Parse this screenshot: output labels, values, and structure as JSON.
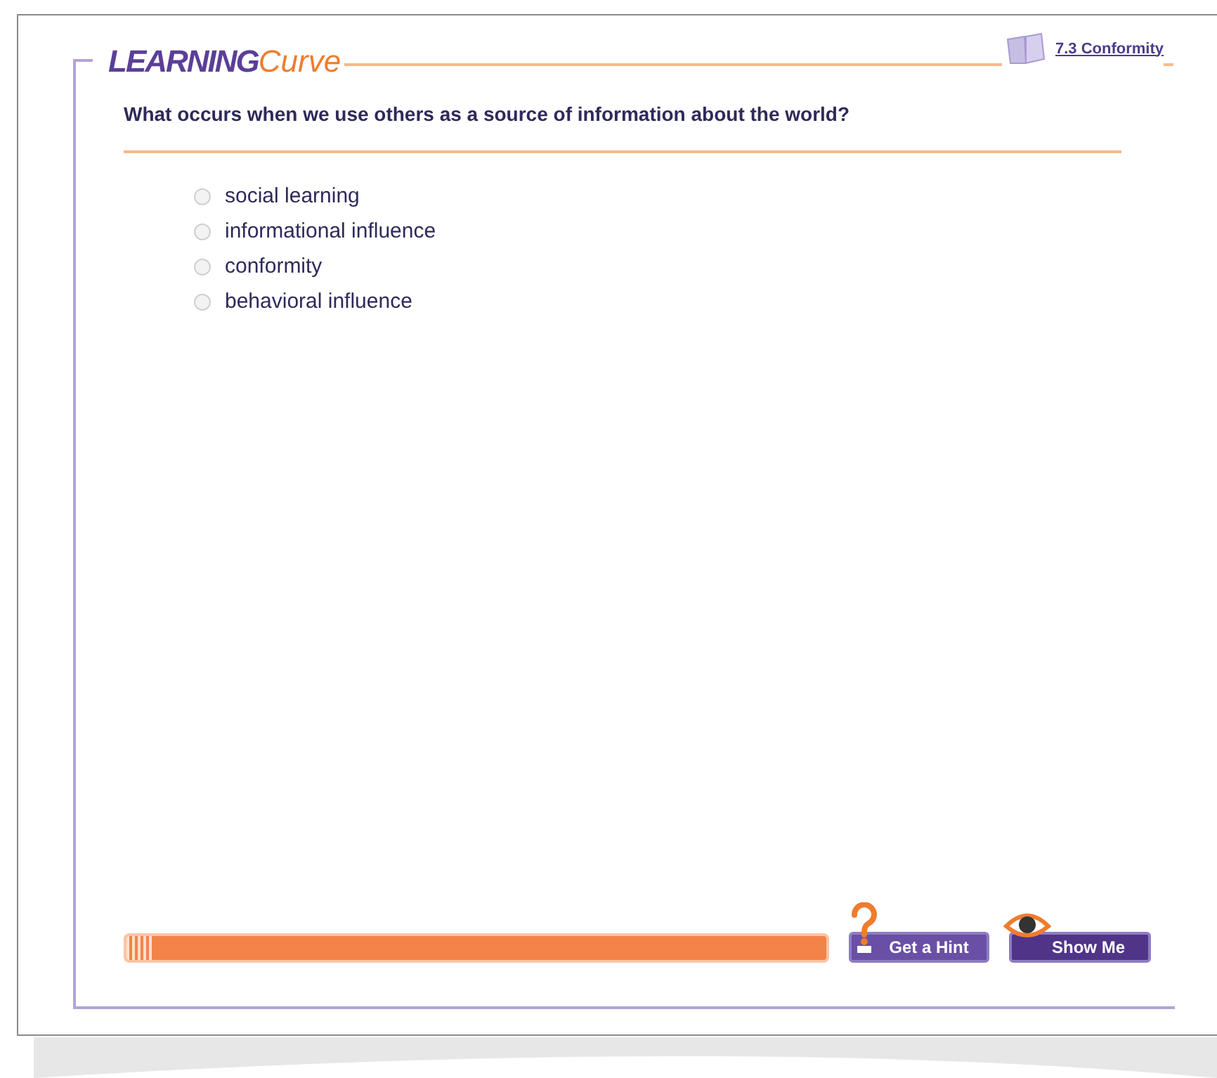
{
  "logo": {
    "parts": [
      "LEARNING",
      "Curve"
    ]
  },
  "section_link": "7.3 Conformity",
  "question": "What occurs when we use others as a source of information about the world?",
  "options": [
    {
      "label": "social learning",
      "selected": false
    },
    {
      "label": "informational influence",
      "selected": false
    },
    {
      "label": "conformity",
      "selected": false
    },
    {
      "label": "behavioral influence",
      "selected": false
    }
  ],
  "progress": {
    "level": 0.04
  },
  "buttons": [
    {
      "kind": "hint",
      "label": "Get a Hint"
    },
    {
      "kind": "show",
      "label": "Show Me"
    }
  ]
}
